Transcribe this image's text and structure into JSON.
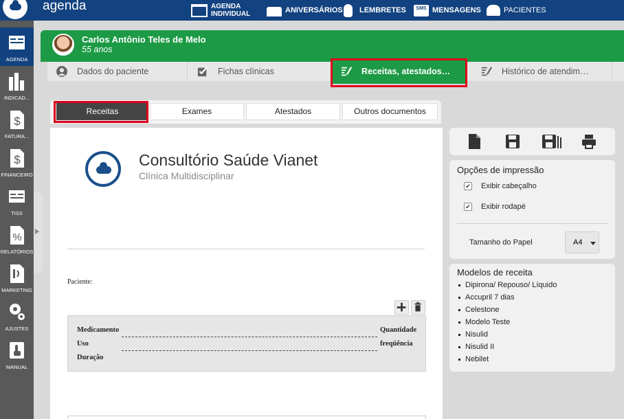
{
  "app": {
    "title": "agenda"
  },
  "topnav": [
    {
      "label": "AGENDA",
      "label2": "INDIVIDUAL",
      "icon": "calendar-icon"
    },
    {
      "label": "ANIVERSÁRIOS",
      "icon": "cake-icon"
    },
    {
      "label": "LEMBRETES",
      "icon": "lightbulb-icon"
    },
    {
      "label": "MENSAGENS",
      "icon": "sms-icon",
      "icon_text": "SMS"
    },
    {
      "label": "PACIENTES",
      "icon": "users-icon"
    }
  ],
  "sidebar": {
    "items": [
      {
        "label": "AGENDA",
        "icon": "calendar-icon",
        "active": true
      },
      {
        "label": "INDICAD...",
        "icon": "bar-chart-icon"
      },
      {
        "label": "FATURA...",
        "icon": "dollar-document-icon"
      },
      {
        "label": "FINANCEIRO",
        "icon": "dollar-document-icon"
      },
      {
        "label": "TISS",
        "icon": "document-grid-icon"
      },
      {
        "label": "RELATÓRIOS",
        "icon": "percent-document-icon"
      },
      {
        "label": "MARKETING",
        "icon": "marketing-icon"
      },
      {
        "label": "AJUSTES",
        "icon": "gears-icon"
      },
      {
        "label": "MANUAL",
        "icon": "touch-hand-icon"
      }
    ]
  },
  "patient": {
    "name": "Carlos Antônio Teles de Melo",
    "age": "55 anos"
  },
  "main_tabs": [
    {
      "label": "Dados do paciente",
      "icon": "person-icon"
    },
    {
      "label": "Fichas clínicas",
      "icon": "checklist-icon"
    },
    {
      "label": "Receitas, atestados…",
      "icon": "prescription-icon",
      "active": true
    },
    {
      "label": "Histórico de atendim…",
      "icon": "prescription-icon"
    }
  ],
  "sub_tabs": [
    {
      "label": "Receitas",
      "active": true
    },
    {
      "label": "Exames"
    },
    {
      "label": "Atestados"
    },
    {
      "label": "Outros documentos"
    }
  ],
  "document": {
    "clinic_name": "Consultório Saúde Vianet",
    "clinic_subtitle": "Clínica Multidisciplinar",
    "patient_label": "Paciente:",
    "fields": {
      "medicamento": "Medicamento",
      "uso": "Uso",
      "duracao": "Duração",
      "quantidade": "Quantidade",
      "frequencia": "freqüência"
    }
  },
  "print_options": {
    "title": "Opções de impressão",
    "show_header": {
      "label": "Exibir cabeçalho",
      "checked": true
    },
    "show_footer": {
      "label": "Exibir rodapé",
      "checked": true
    },
    "paper_size_label": "Tamanho do Papel",
    "paper_size_value": "A4"
  },
  "models": {
    "title": "Modelos de receita",
    "items": [
      "Dipirona/ Repouso/ Líquido",
      "Accupril 7 dias",
      "Celestone",
      "Modelo Teste",
      "Nisulid",
      "Nisulid II",
      "Nebilet"
    ]
  },
  "colors": {
    "topbar": "#12427f",
    "accent_green": "#1c9a45",
    "highlight_red": "#e0001b",
    "sidebar": "#595959"
  }
}
